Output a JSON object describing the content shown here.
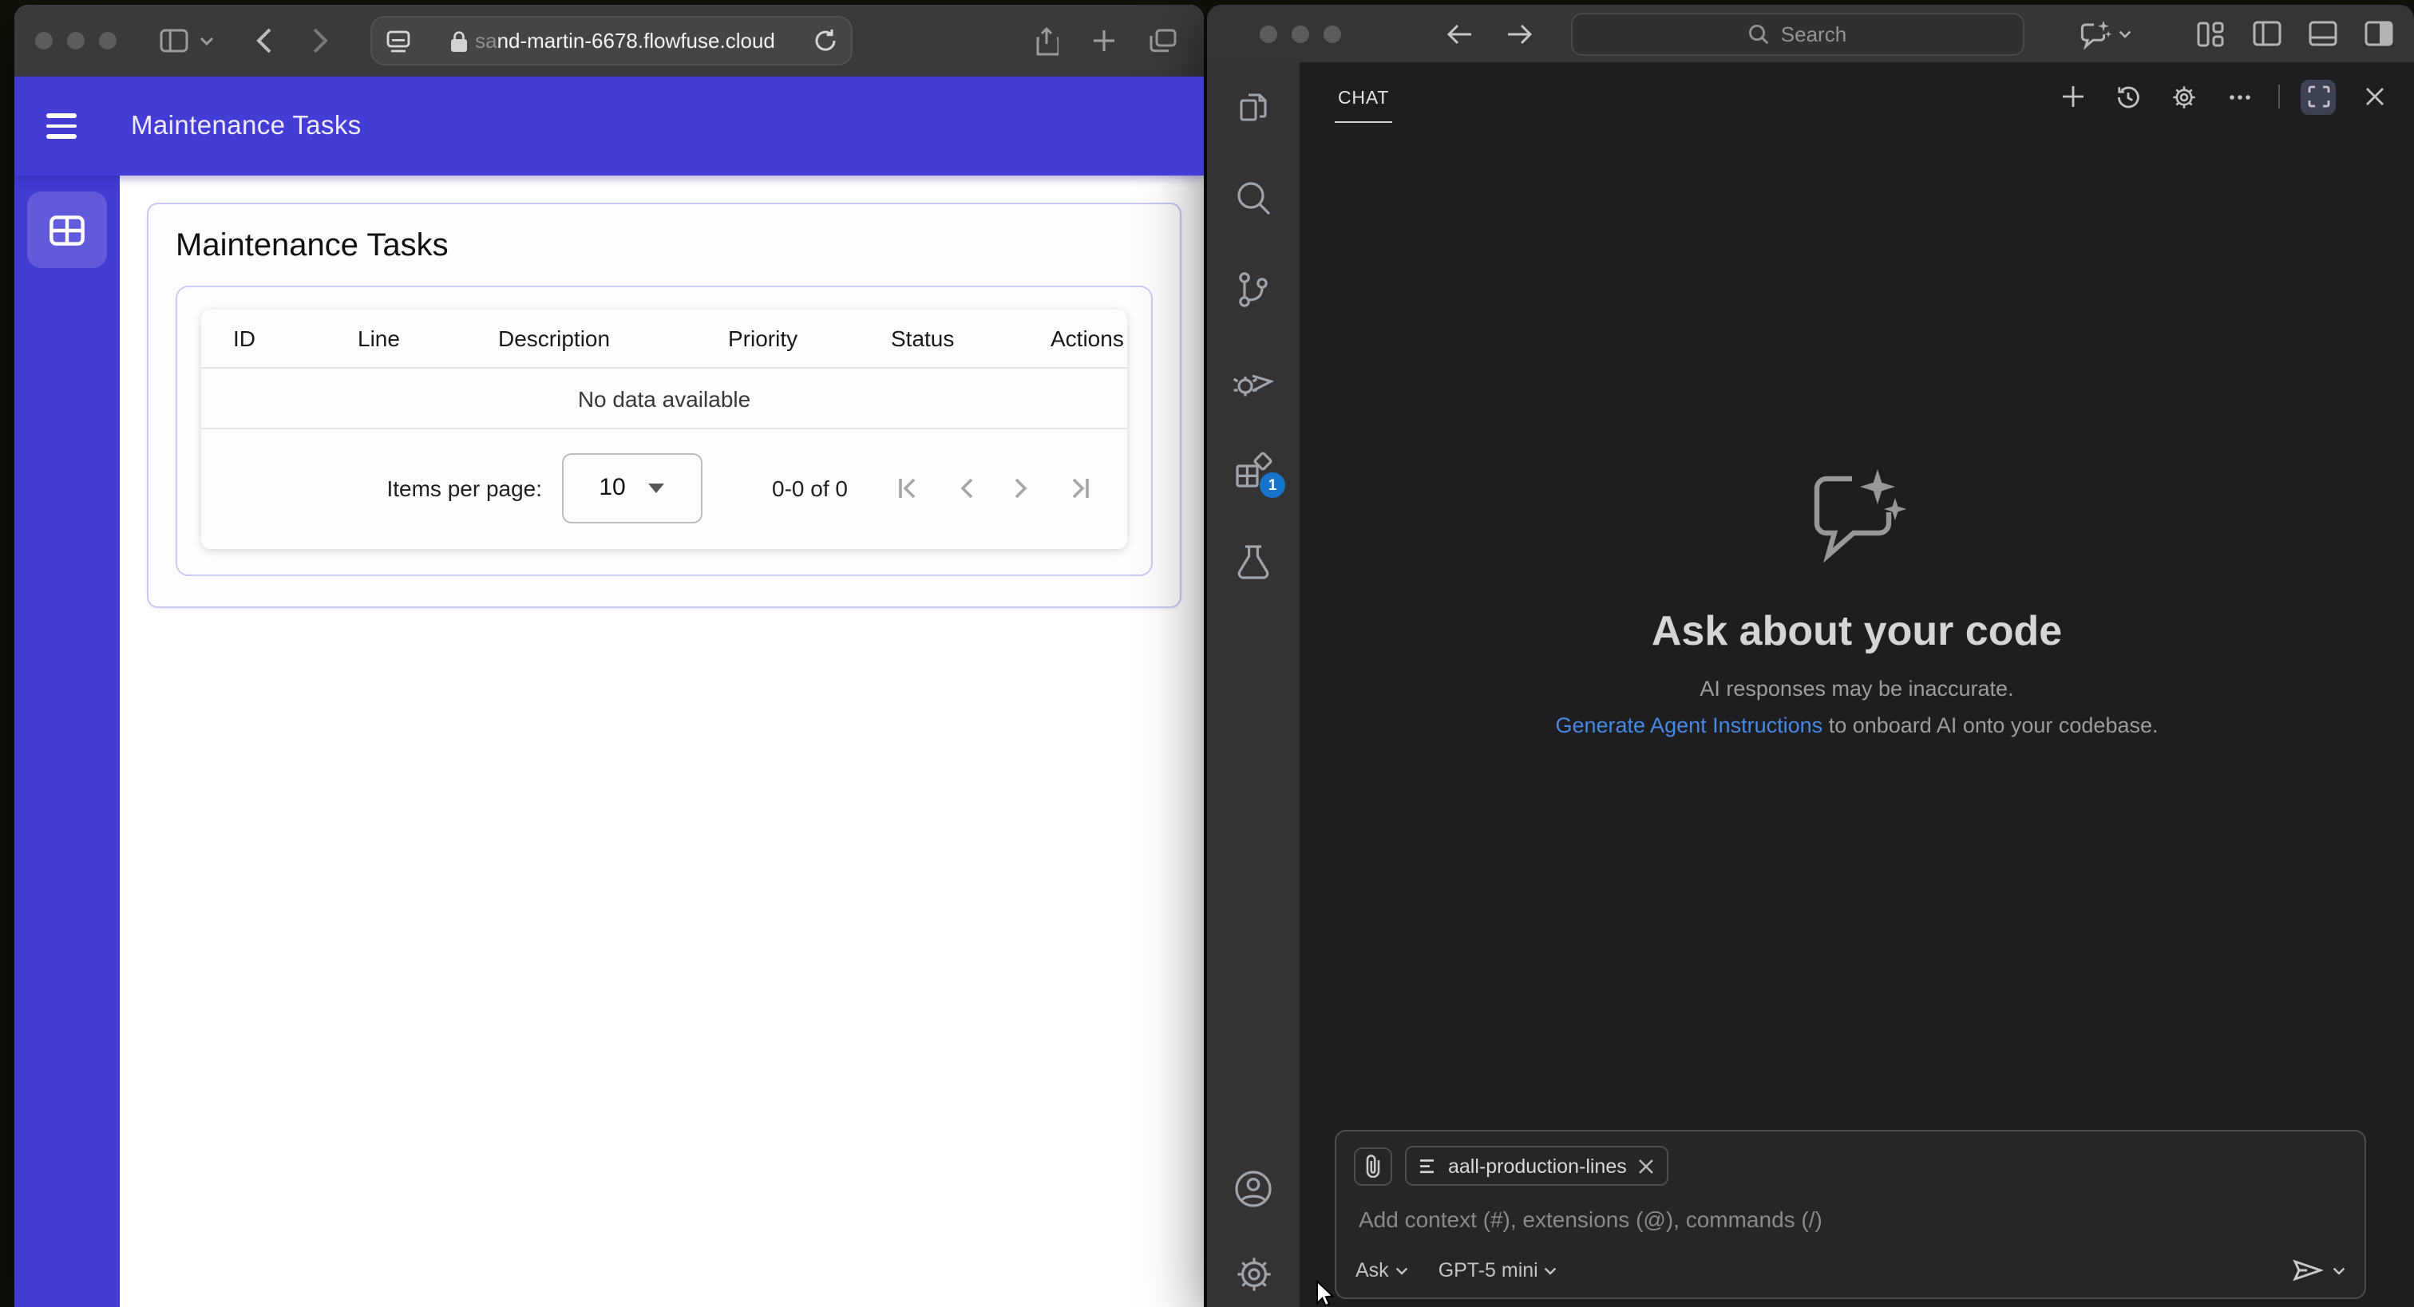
{
  "browser": {
    "url_prefix": "sa",
    "url_main": "nd-martin-6678.flowfuse.cloud",
    "app": {
      "header_title": "Maintenance Tasks",
      "card_title": "Maintenance Tasks",
      "table": {
        "headers": [
          "ID",
          "Line",
          "Description",
          "Priority",
          "Status",
          "Actions"
        ],
        "empty_text": "No data available"
      },
      "footer": {
        "items_per_page_label": "Items per page:",
        "page_size": "10",
        "range_text": "0-0 of 0"
      }
    }
  },
  "vscode": {
    "titlebar": {
      "search_placeholder": "Search"
    },
    "activity_bar": {
      "extensions_badge": "1"
    },
    "chat": {
      "tab_label": "CHAT",
      "empty_state": {
        "title": "Ask about your code",
        "subtitle": "AI responses may be inaccurate.",
        "link_text": "Generate Agent Instructions",
        "link_suffix": " to onboard AI onto your codebase."
      },
      "input": {
        "attachment_chip": "aall-production-lines",
        "placeholder": "Add context (#), extensions (@), commands (/)",
        "mode_label": "Ask",
        "model_label": "GPT-5 mini"
      }
    }
  },
  "colors": {
    "app_primary": "#453cd6",
    "link_blue": "#4688e4",
    "badge_blue": "#1874ca"
  }
}
